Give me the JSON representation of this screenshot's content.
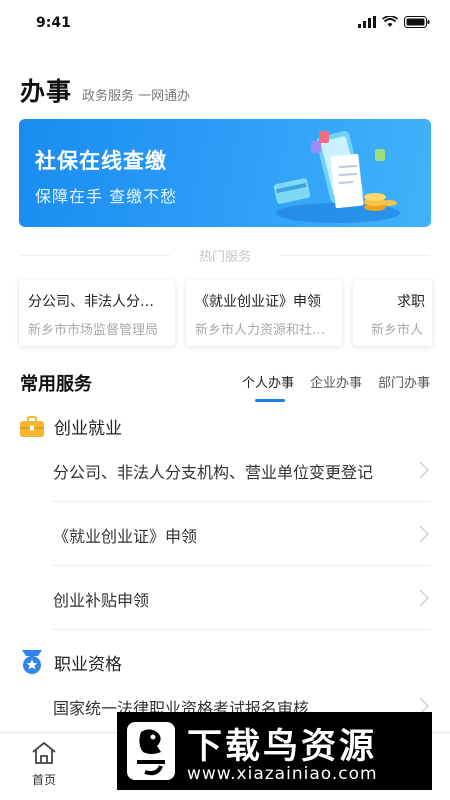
{
  "status_bar": {
    "time": "9:41"
  },
  "header": {
    "title": "办事",
    "subtitle": "政务服务 一网通办"
  },
  "banner": {
    "title": "社保在线查缴",
    "subtitle": "保障在手  查缴不愁"
  },
  "hot_services": {
    "title": "热门服务",
    "cards": [
      {
        "name": "分公司、非法人分支机构、营业单位变更登记",
        "org": "新乡市市场监督管理局"
      },
      {
        "name": "《就业创业证》申领",
        "org": "新乡市人力资源和社会保障局"
      },
      {
        "name": "求职",
        "org": "新乡市人"
      }
    ]
  },
  "common_services": {
    "title": "常用服务",
    "tabs": [
      {
        "label": "个人办事",
        "active": true
      },
      {
        "label": "企业办事",
        "active": false
      },
      {
        "label": "部门办事",
        "active": false
      }
    ]
  },
  "categories": [
    {
      "title": "创业就业",
      "icon": "briefcase-icon",
      "items": [
        "分公司、非法人分支机构、营业单位变更登记",
        "《就业创业证》申领",
        "创业补贴申领"
      ]
    },
    {
      "title": "职业资格",
      "icon": "medal-icon",
      "items": [
        "国家统一法律职业资格考试报名审核"
      ]
    }
  ],
  "tabbar": {
    "home_label": "首页"
  },
  "watermark": {
    "brand": "下载鸟资源",
    "url": "www.xiazainiao.com"
  },
  "colors": {
    "accent": "#1e7ee8",
    "banner_start": "#1a8cf0",
    "banner_end": "#41b3fb",
    "briefcase": "#f5b731",
    "medal": "#2f86e8"
  }
}
